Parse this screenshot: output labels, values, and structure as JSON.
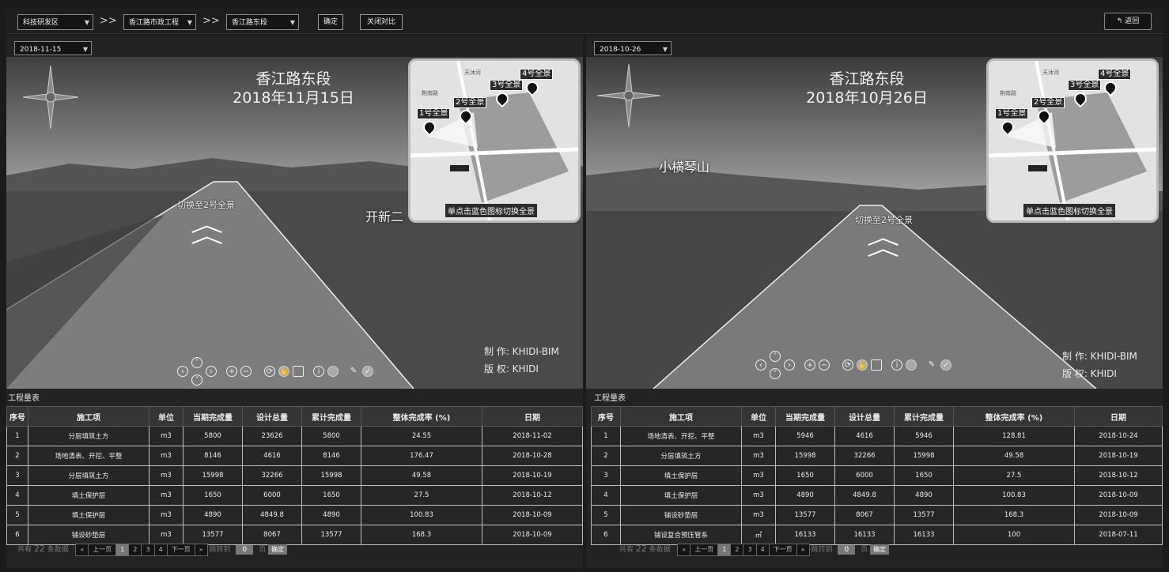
{
  "toolbar": {
    "zone": "科技研发区",
    "project": "香江路市政工程",
    "section": "香江路东段",
    "separator": ">>",
    "confirm_label": "确定",
    "compare_close_label": "关闭对比",
    "back_label": "返回",
    "back_icon": "↰"
  },
  "left": {
    "date": "2018-11-15",
    "title_line1": "香江路东段",
    "title_line2": "2018年11月15日",
    "switch_label": "切换至2号全景",
    "overlay_text": "开新二",
    "credit_make": "制 作: KHIDI-BIM",
    "credit_copy": "版 权: KHIDI",
    "minimap_tip": "单点击蓝色图标切换全景",
    "pins": [
      "1号全景",
      "2号全景",
      "3号全景",
      "4号全景"
    ],
    "table_title": "工程量表",
    "headers": [
      "序号",
      "施工项",
      "单位",
      "当期完成量",
      "设计总量",
      "累计完成量",
      "整体完成率 (%)",
      "日期"
    ],
    "rows": [
      [
        "1",
        "分层填筑土方",
        "m3",
        "5800",
        "23626",
        "5800",
        "24.55",
        "2018-11-02"
      ],
      [
        "2",
        "场地清表、开挖、平整",
        "m3",
        "8146",
        "4616",
        "8146",
        "176.47",
        "2018-10-28"
      ],
      [
        "3",
        "分层填筑土方",
        "m3",
        "15998",
        "32266",
        "15998",
        "49.58",
        "2018-10-19"
      ],
      [
        "4",
        "填土保护层",
        "m3",
        "1650",
        "6000",
        "1650",
        "27.5",
        "2018-10-12"
      ],
      [
        "5",
        "填土保护层",
        "m3",
        "4890",
        "4849.8",
        "4890",
        "100.83",
        "2018-10-09"
      ],
      [
        "6",
        "铺设砂垫层",
        "m3",
        "13577",
        "8067",
        "13577",
        "168.3",
        "2018-10-09"
      ]
    ],
    "pager": {
      "total_prefix": "共有",
      "total": "22",
      "total_suffix": "条数据",
      "first": "«",
      "prev": "上一页",
      "pages": [
        "1",
        "2",
        "3",
        "4"
      ],
      "next": "下一页",
      "last": "»",
      "jump_label": "跳转到",
      "jump_value": "0",
      "page_unit": "页",
      "go": "确定"
    }
  },
  "right": {
    "date": "2018-10-26",
    "title_line1": "香江路东段",
    "title_line2": "2018年10月26日",
    "switch_label": "切换至2号全景",
    "overlay_text": "小横琴山",
    "credit_make": "制 作: KHIDI-BIM",
    "credit_copy": "版 权: KHIDI",
    "minimap_tip": "单点击蓝色图标切换全景",
    "pins": [
      "1号全景",
      "2号全景",
      "3号全景",
      "4号全景"
    ],
    "table_title": "工程量表",
    "headers": [
      "序号",
      "施工项",
      "单位",
      "当期完成量",
      "设计总量",
      "累计完成量",
      "整体完成率 (%)",
      "日期"
    ],
    "rows": [
      [
        "1",
        "场地清表、开挖、平整",
        "m3",
        "5946",
        "4616",
        "5946",
        "128.81",
        "2018-10-24"
      ],
      [
        "2",
        "分层填筑土方",
        "m3",
        "15998",
        "32266",
        "15998",
        "49.58",
        "2018-10-19"
      ],
      [
        "3",
        "填土保护层",
        "m3",
        "1650",
        "6000",
        "1650",
        "27.5",
        "2018-10-12"
      ],
      [
        "4",
        "填土保护层",
        "m3",
        "4890",
        "4849.8",
        "4890",
        "100.83",
        "2018-10-09"
      ],
      [
        "5",
        "铺设砂垫层",
        "m3",
        "13577",
        "8067",
        "13577",
        "168.3",
        "2018-10-09"
      ],
      [
        "6",
        "铺设复合预压管系",
        "㎡",
        "16133",
        "16133",
        "16133",
        "100",
        "2018-07-11"
      ]
    ],
    "pager": {
      "total_prefix": "共有",
      "total": "22",
      "total_suffix": "条数据",
      "first": "«",
      "prev": "上一页",
      "pages": [
        "1",
        "2",
        "3",
        "4"
      ],
      "next": "下一页",
      "last": "»",
      "jump_label": "跳转到",
      "jump_value": "0",
      "page_unit": "页",
      "go": "确定"
    }
  },
  "minimap_labels": [
    "天沐河",
    "荆南路"
  ],
  "nav_icons": [
    "left",
    "up",
    "down",
    "right",
    "zoom-in",
    "zoom-out",
    "rotate",
    "drag",
    "fullscreen",
    "info",
    "record",
    "pen",
    "check"
  ]
}
